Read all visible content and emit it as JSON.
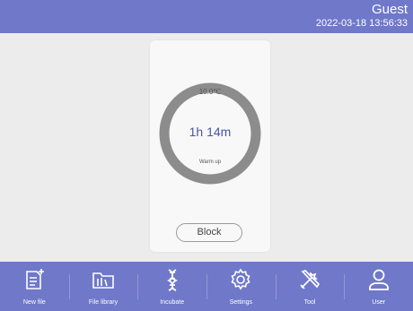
{
  "header": {
    "user": "Guest",
    "datetime": "2022-03-18 13:56:33"
  },
  "status_card": {
    "temperature": "10.0℃",
    "timer": "1h 14m",
    "stage": "Warm up",
    "block_button": "Block"
  },
  "navbar": {
    "items": [
      {
        "label": "New file",
        "icon": "new-file-icon"
      },
      {
        "label": "File library",
        "icon": "folder-icon"
      },
      {
        "label": "Incubate",
        "icon": "dna-icon"
      },
      {
        "label": "Settings",
        "icon": "gear-icon"
      },
      {
        "label": "Tool",
        "icon": "tools-icon"
      },
      {
        "label": "User",
        "icon": "user-icon"
      }
    ]
  },
  "colors": {
    "bar": "#6f78c9",
    "ring": "#8c8c8c",
    "timer_text": "#4b55a8",
    "background": "#ececec"
  }
}
